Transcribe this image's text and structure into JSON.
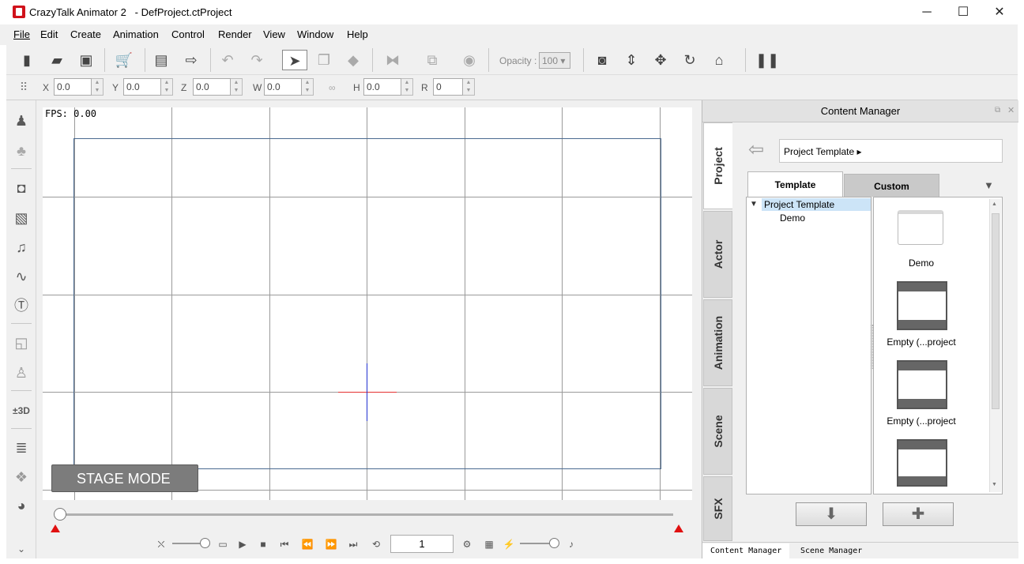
{
  "window": {
    "app_name": "CrazyTalk Animator 2",
    "document": "- DefProject.ctProject",
    "minimize": "─",
    "maximize": "☐",
    "close": "✕"
  },
  "menu": [
    "File",
    "Edit",
    "Create",
    "Animation",
    "Control",
    "Render",
    "View",
    "Window",
    "Help"
  ],
  "toolbar": {
    "opacity_label": "Opacity :",
    "opacity_value": "100"
  },
  "transform": {
    "x_label": "X",
    "x_value": "0.0",
    "y_label": "Y",
    "y_value": "0.0",
    "z_label": "Z",
    "z_value": "0.0",
    "w_label": "W",
    "w_value": "0.0",
    "h_label": "H",
    "h_value": "0.0",
    "r_label": "R",
    "r_value": "0"
  },
  "stage": {
    "fps": "FPS: 0.00",
    "mode_label": "STAGE MODE"
  },
  "playback": {
    "current_frame": "1"
  },
  "content_manager": {
    "title": "Content Manager",
    "side_tabs": [
      "Project",
      "Actor",
      "Animation",
      "Scene",
      "SFX"
    ],
    "path": "Project Template",
    "tabs": [
      "Template",
      "Custom"
    ],
    "tree_root": "Project Template",
    "tree_child": "Demo",
    "items": [
      "Demo",
      "Empty (...project",
      "Empty (...project"
    ],
    "bottom_tabs": [
      "Content Manager",
      "Scene Manager"
    ]
  },
  "colors": {
    "accent_red": "#d0121b",
    "stage_frame": "#4a6a90",
    "selection": "#cce4f7"
  }
}
